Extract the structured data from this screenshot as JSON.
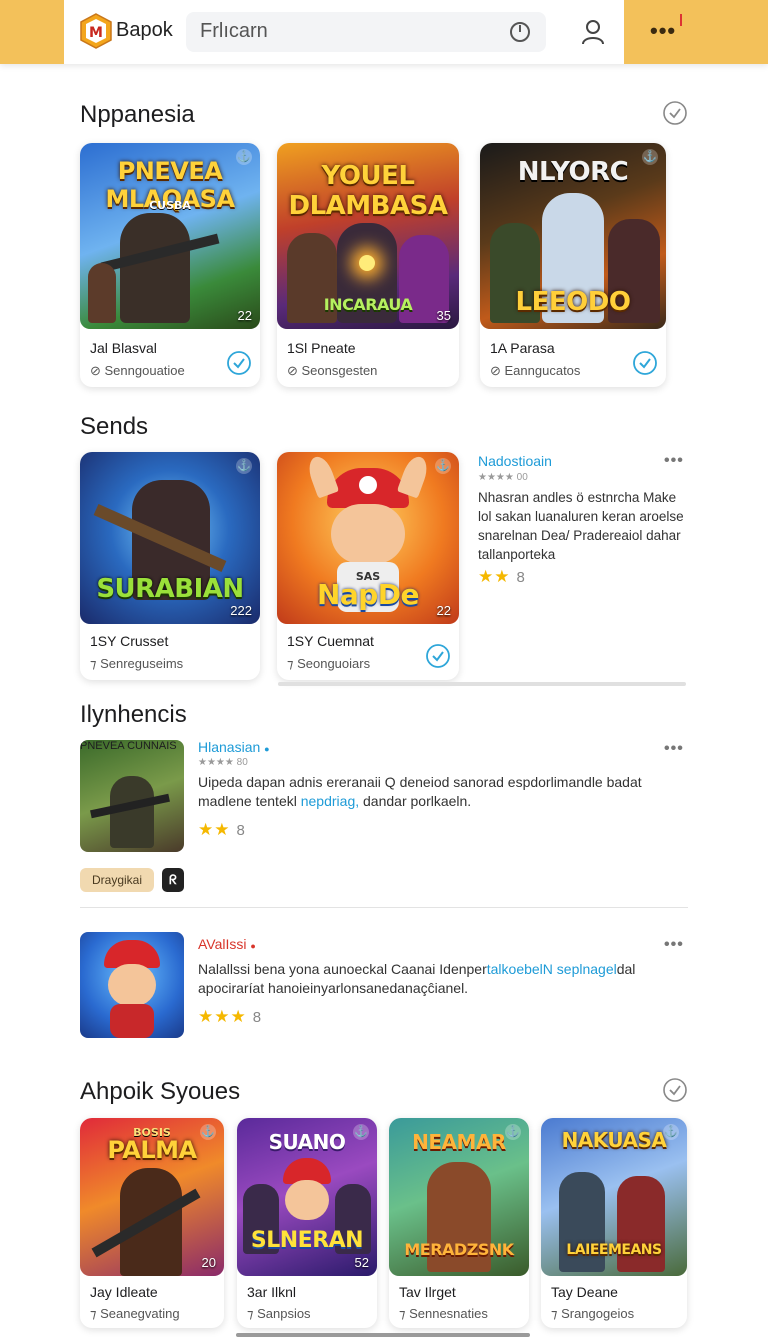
{
  "header": {
    "brand": "Bapok",
    "search_value": "Frlıcarn",
    "icons": [
      "logo-icon",
      "clock-icon",
      "user-icon",
      "more-icon"
    ],
    "accent_color": "#f3c15a"
  },
  "sections": {
    "s1": {
      "title": "Nppanesia",
      "cards": [
        {
          "headline": "PNEVEA MLAQASA",
          "tag": "CUSBA",
          "num": "22",
          "title": "Jal Blasval",
          "subtitle": "Senngouatioe",
          "checked": true
        },
        {
          "headline": "YOUEL DLAMBASA",
          "tag": "INCARAUA",
          "num": "35",
          "title": "1Sl Pneate",
          "subtitle": "Seonsgesten",
          "checked": false
        },
        {
          "headline": "NLYORC",
          "tag": "LEEODO",
          "num": "",
          "title": "1A Parasa",
          "subtitle": "Eanngucatos",
          "checked": true
        }
      ]
    },
    "s2": {
      "title": "Sends",
      "cards": [
        {
          "headline": "SURABIAN",
          "tag": "",
          "num": "222",
          "title": "1SY Crusset",
          "subtitle": "Senreguseims",
          "checked": false
        },
        {
          "headline": "NapDe",
          "tag": "SAS",
          "num": "22",
          "title": "1SY Cuemnat",
          "subtitle": "Seonguoiars",
          "checked": true
        }
      ],
      "side": {
        "title": "Nadostioain",
        "meta": "★★★★ 00",
        "desc": "Nhasran andles ö estnrcha Make lol sakan luanaluren keran aroelse snarelnan Dea/ Pradereaiol dahar tallanporteka",
        "stars": "★★",
        "count": "8"
      }
    },
    "s3": {
      "title": "Ilynhencis",
      "rows": [
        {
          "thumb_label": "PNEVEA CUNNAIS",
          "title": "Hlanasian",
          "meta": "★★★★ 80",
          "desc_a": "Uipeda dapan adnis ereranaii Q deneiod sanorad espdorlimandle badat madlene tentekl ",
          "desc_link": "nepdriag,",
          "desc_b": " dandar porlkaeln.",
          "stars": "★★",
          "count": "8",
          "tag": "Draygikai",
          "tag_icon": "ᖇ"
        },
        {
          "thumb_label": "",
          "title": "AValIssi",
          "meta": "",
          "desc_a": "Nalallssi bena yona aunoeckal Caanai Idenper",
          "desc_link": "talkoebelN seplnagel",
          "desc_b": "dal apociraríat hanoieinyarlonsanedanaçĉianel.",
          "stars": "★★★",
          "count": "8"
        }
      ]
    },
    "s4": {
      "title": "Ahpoik Syoues",
      "cards": [
        {
          "headline": "PALMA",
          "tag": "BOSIS",
          "num": "20",
          "title": "Jay Idleate",
          "subtitle": "Seanegvating"
        },
        {
          "headline": "SUANO",
          "tag": "SLNERAN",
          "num": "52",
          "title": "3ar Ilknl",
          "subtitle": "Sanpsios"
        },
        {
          "headline": "NEAMAR",
          "tag": "MERADZSNK",
          "num": "",
          "title": "Tav Ilrget",
          "subtitle": "Sennesnaties"
        },
        {
          "headline": "NAKUASA",
          "tag": "LAIEEMEANS",
          "num": "",
          "title": "Tay Deane",
          "subtitle": "Srangogeios"
        }
      ]
    }
  }
}
